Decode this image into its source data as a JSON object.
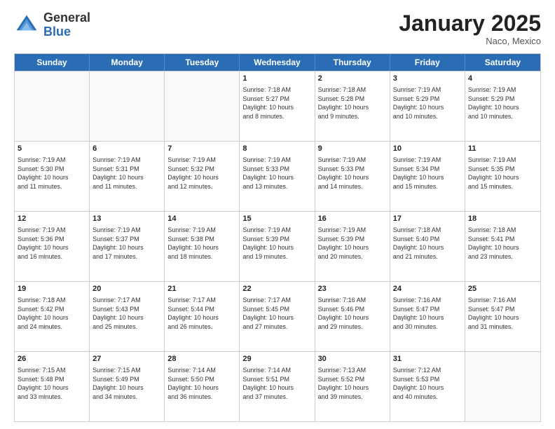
{
  "header": {
    "logo_general": "General",
    "logo_blue": "Blue",
    "month_title": "January 2025",
    "location": "Naco, Mexico"
  },
  "calendar": {
    "days_of_week": [
      "Sunday",
      "Monday",
      "Tuesday",
      "Wednesday",
      "Thursday",
      "Friday",
      "Saturday"
    ],
    "rows": [
      [
        {
          "day": "",
          "info": "",
          "empty": true
        },
        {
          "day": "",
          "info": "",
          "empty": true
        },
        {
          "day": "",
          "info": "",
          "empty": true
        },
        {
          "day": "1",
          "info": "Sunrise: 7:18 AM\nSunset: 5:27 PM\nDaylight: 10 hours\nand 8 minutes."
        },
        {
          "day": "2",
          "info": "Sunrise: 7:18 AM\nSunset: 5:28 PM\nDaylight: 10 hours\nand 9 minutes."
        },
        {
          "day": "3",
          "info": "Sunrise: 7:19 AM\nSunset: 5:29 PM\nDaylight: 10 hours\nand 10 minutes."
        },
        {
          "day": "4",
          "info": "Sunrise: 7:19 AM\nSunset: 5:29 PM\nDaylight: 10 hours\nand 10 minutes."
        }
      ],
      [
        {
          "day": "5",
          "info": "Sunrise: 7:19 AM\nSunset: 5:30 PM\nDaylight: 10 hours\nand 11 minutes."
        },
        {
          "day": "6",
          "info": "Sunrise: 7:19 AM\nSunset: 5:31 PM\nDaylight: 10 hours\nand 11 minutes."
        },
        {
          "day": "7",
          "info": "Sunrise: 7:19 AM\nSunset: 5:32 PM\nDaylight: 10 hours\nand 12 minutes."
        },
        {
          "day": "8",
          "info": "Sunrise: 7:19 AM\nSunset: 5:33 PM\nDaylight: 10 hours\nand 13 minutes."
        },
        {
          "day": "9",
          "info": "Sunrise: 7:19 AM\nSunset: 5:33 PM\nDaylight: 10 hours\nand 14 minutes."
        },
        {
          "day": "10",
          "info": "Sunrise: 7:19 AM\nSunset: 5:34 PM\nDaylight: 10 hours\nand 15 minutes."
        },
        {
          "day": "11",
          "info": "Sunrise: 7:19 AM\nSunset: 5:35 PM\nDaylight: 10 hours\nand 15 minutes."
        }
      ],
      [
        {
          "day": "12",
          "info": "Sunrise: 7:19 AM\nSunset: 5:36 PM\nDaylight: 10 hours\nand 16 minutes."
        },
        {
          "day": "13",
          "info": "Sunrise: 7:19 AM\nSunset: 5:37 PM\nDaylight: 10 hours\nand 17 minutes."
        },
        {
          "day": "14",
          "info": "Sunrise: 7:19 AM\nSunset: 5:38 PM\nDaylight: 10 hours\nand 18 minutes."
        },
        {
          "day": "15",
          "info": "Sunrise: 7:19 AM\nSunset: 5:39 PM\nDaylight: 10 hours\nand 19 minutes."
        },
        {
          "day": "16",
          "info": "Sunrise: 7:19 AM\nSunset: 5:39 PM\nDaylight: 10 hours\nand 20 minutes."
        },
        {
          "day": "17",
          "info": "Sunrise: 7:18 AM\nSunset: 5:40 PM\nDaylight: 10 hours\nand 21 minutes."
        },
        {
          "day": "18",
          "info": "Sunrise: 7:18 AM\nSunset: 5:41 PM\nDaylight: 10 hours\nand 23 minutes."
        }
      ],
      [
        {
          "day": "19",
          "info": "Sunrise: 7:18 AM\nSunset: 5:42 PM\nDaylight: 10 hours\nand 24 minutes."
        },
        {
          "day": "20",
          "info": "Sunrise: 7:17 AM\nSunset: 5:43 PM\nDaylight: 10 hours\nand 25 minutes."
        },
        {
          "day": "21",
          "info": "Sunrise: 7:17 AM\nSunset: 5:44 PM\nDaylight: 10 hours\nand 26 minutes."
        },
        {
          "day": "22",
          "info": "Sunrise: 7:17 AM\nSunset: 5:45 PM\nDaylight: 10 hours\nand 27 minutes."
        },
        {
          "day": "23",
          "info": "Sunrise: 7:16 AM\nSunset: 5:46 PM\nDaylight: 10 hours\nand 29 minutes."
        },
        {
          "day": "24",
          "info": "Sunrise: 7:16 AM\nSunset: 5:47 PM\nDaylight: 10 hours\nand 30 minutes."
        },
        {
          "day": "25",
          "info": "Sunrise: 7:16 AM\nSunset: 5:47 PM\nDaylight: 10 hours\nand 31 minutes."
        }
      ],
      [
        {
          "day": "26",
          "info": "Sunrise: 7:15 AM\nSunset: 5:48 PM\nDaylight: 10 hours\nand 33 minutes."
        },
        {
          "day": "27",
          "info": "Sunrise: 7:15 AM\nSunset: 5:49 PM\nDaylight: 10 hours\nand 34 minutes."
        },
        {
          "day": "28",
          "info": "Sunrise: 7:14 AM\nSunset: 5:50 PM\nDaylight: 10 hours\nand 36 minutes."
        },
        {
          "day": "29",
          "info": "Sunrise: 7:14 AM\nSunset: 5:51 PM\nDaylight: 10 hours\nand 37 minutes."
        },
        {
          "day": "30",
          "info": "Sunrise: 7:13 AM\nSunset: 5:52 PM\nDaylight: 10 hours\nand 39 minutes."
        },
        {
          "day": "31",
          "info": "Sunrise: 7:12 AM\nSunset: 5:53 PM\nDaylight: 10 hours\nand 40 minutes."
        },
        {
          "day": "",
          "info": "",
          "empty": true
        }
      ]
    ]
  }
}
